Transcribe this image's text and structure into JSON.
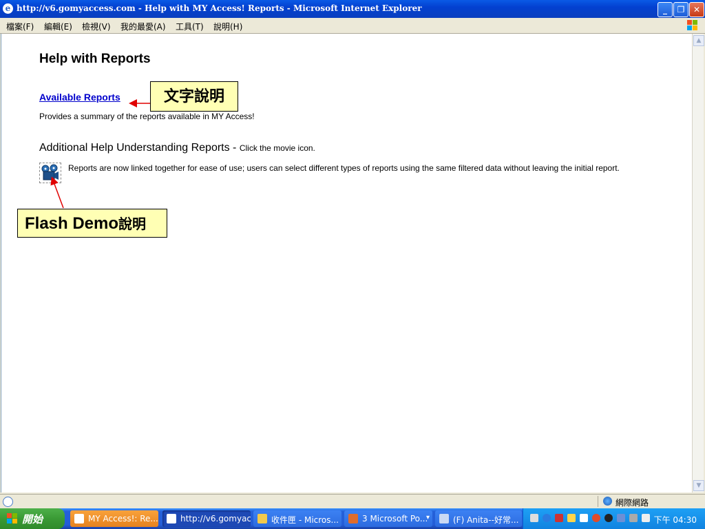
{
  "window": {
    "title": "http://v6.gomyaccess.com - Help with MY Access! Reports - Microsoft Internet Explorer",
    "minimize": "_",
    "restore": "❐",
    "close": "✕"
  },
  "menu": {
    "items": [
      "檔案(F)",
      "編輯(E)",
      "檢視(V)",
      "我的最愛(A)",
      "工具(T)",
      "說明(H)"
    ]
  },
  "page": {
    "title": "Help with Reports",
    "reports_link": "Available Reports",
    "reports_desc": "Provides a summary of the reports available in MY Access!",
    "additional_heading": "Additional Help Understanding Reports -",
    "additional_hint": "Click the movie icon.",
    "movie_desc": "Reports are now linked together for ease of use; users can select different types of reports using the same filtered data without leaving the initial report."
  },
  "callouts": {
    "text_note": "文字說明",
    "flash_label": "Flash Demo",
    "flash_cjk": "說明"
  },
  "statusbar": {
    "zone": "網際網路"
  },
  "taskbar": {
    "start": "開始",
    "tasks": [
      "MY Access!: Re...",
      "http://v6.gomyac...",
      "收件匣 - Micros...",
      "3 Microsoft Po...",
      "(F) Anita--好常..."
    ],
    "clock": "下午 04:30"
  },
  "colors": {
    "link": "#0000cc",
    "callout_bg": "#ffffb4",
    "arrow": "#e00000",
    "titlebar": "#0a4fd6"
  }
}
